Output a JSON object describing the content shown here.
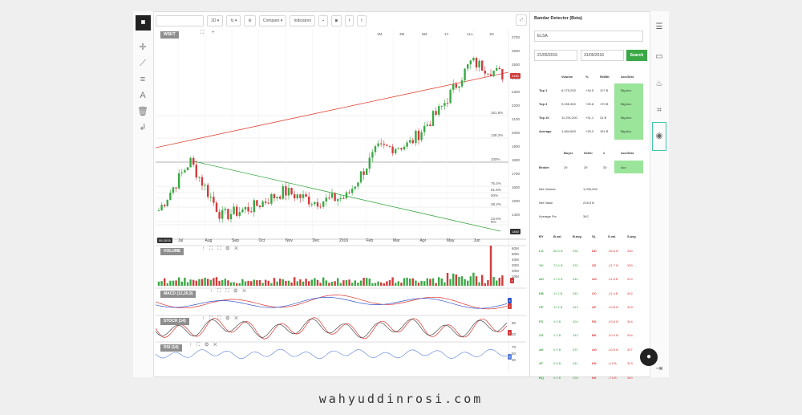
{
  "toolbar": {
    "interval": "1D",
    "compare": "Compare",
    "indicators": "Indicators"
  },
  "main_chart": {
    "symbol": "WSKT",
    "ranges": [
      "1M",
      "3M",
      "6M",
      "1Y",
      "ALL"
    ],
    "range_extra": "1D",
    "ytick_labels": [
      "2700",
      "2600",
      "2500",
      "2400",
      "2300",
      "2200",
      "2100",
      "2000",
      "1900",
      "1800",
      "1700",
      "1600",
      "1500",
      "1400"
    ],
    "fib_levels": [
      "161.8%",
      "138.2%",
      "100%",
      "76.4%",
      "61.8%",
      "50%",
      "38.2%",
      "23.6%",
      "0%"
    ],
    "x_labels": [
      "Jul",
      "Aug",
      "Sep",
      "Oct",
      "Nov",
      "Dec",
      "2016",
      "Feb",
      "Mar",
      "Apr",
      "May",
      "Jun"
    ],
    "left_date": "09-2015",
    "price_tag": "2480",
    "low_tag": "1460"
  },
  "indicators": {
    "volume": "VOLUME",
    "macd": "MACD (12,26,9)",
    "stoch": "STOCH (14)",
    "rsi": "RSI (14)",
    "volume_scale": [
      "60M",
      "50M",
      "40M",
      "30M",
      "20M",
      "10M"
    ],
    "stoch_scale": [
      "80",
      "20"
    ],
    "rsi_scale": [
      "70",
      "50",
      "30"
    ]
  },
  "chart_data": {
    "type": "line",
    "title": "WSKT",
    "x": [
      "Jul",
      "Aug",
      "Sep",
      "Oct",
      "Nov",
      "Dec",
      "2016",
      "Feb",
      "Mar",
      "Apr",
      "May",
      "Jun"
    ],
    "series": [
      {
        "name": "WSKT",
        "values": [
          1560,
          1900,
          1520,
          1580,
          1690,
          1620,
          1650,
          1980,
          2010,
          2250,
          2580,
          2490
        ]
      }
    ],
    "ylim": [
      1400,
      2750
    ],
    "fibonacci": [
      "161.8%",
      "138.2%",
      "100%",
      "76.4%",
      "61.8%",
      "50%",
      "38.2%",
      "23.6%",
      "0%"
    ]
  },
  "bandar": {
    "title": "Bandar Detector (Beta)",
    "symbol": "ELSA",
    "date_from": "21/05/2016",
    "date_to": "31/05/2016",
    "search": "Search",
    "table1_headers": [
      "",
      "Volume",
      "%",
      "RelBit",
      "Acc/Dist"
    ],
    "table1_rows": [
      [
        "Top 1",
        "6,175,200",
        "+16.5",
        "117 B",
        "Big Acc"
      ],
      [
        "Top 3",
        "9,035,300",
        "+25.8",
        "170 B",
        "Big Acc"
      ],
      [
        "Top 10",
        "11,291,200",
        "+31.1",
        "31 B",
        "Big Acc"
      ],
      [
        "Average",
        "1,484,663",
        "+25.3",
        "151 B",
        "Big Acc"
      ]
    ],
    "table2_headers": [
      "",
      "Buyer",
      "Seller",
      "#",
      "Acc/Dist"
    ],
    "table2_row": [
      "Broker",
      "29",
      "29",
      "33",
      "Acc"
    ],
    "net_volume_label": "Net Volume",
    "net_volume": "1,035,300",
    "net_value_label": "Net Value",
    "net_value": "218.5 B",
    "avg_price_label": "Average Prc",
    "avg_price": "342",
    "broker_headers": [
      "BY",
      "B.val",
      "B.avg",
      "SL",
      "S.val",
      "S.avg"
    ],
    "broker_rows": [
      [
        "LG",
        "86.5 B",
        "335",
        "DD",
        "-26.6 B",
        "330"
      ],
      [
        "YU",
        "72.4 B",
        "332",
        "ZD",
        "-21.7 B",
        "330"
      ],
      [
        "AH",
        "17.5 B",
        "340",
        "AG",
        "-11.6 B",
        "314"
      ],
      [
        "DB",
        "11.1 B",
        "340",
        "CC",
        "-11.4 B",
        "342"
      ],
      [
        "CP",
        "11.1 B",
        "343",
        "AF",
        "-10.8 B",
        "343"
      ],
      [
        "FS",
        "4.3 B",
        "324",
        "PD",
        "-10.6 B",
        "344"
      ],
      [
        "CS",
        "1.3 B",
        "342",
        "BK",
        "-10.0 B",
        "334"
      ],
      [
        "AK",
        "0.9 B",
        "337",
        "AG",
        "-10.5 B",
        "327"
      ],
      [
        "AT",
        "0.8 B",
        "341",
        "KK",
        "-4.9 B",
        "323"
      ],
      [
        "BQ",
        "0.4 B",
        "328",
        "NX",
        "-7.6 B",
        "340"
      ]
    ],
    "colors": {
      "green": "#3aa845",
      "red": "#d23b3b"
    }
  },
  "footer": "wahyuddinrosi.com"
}
